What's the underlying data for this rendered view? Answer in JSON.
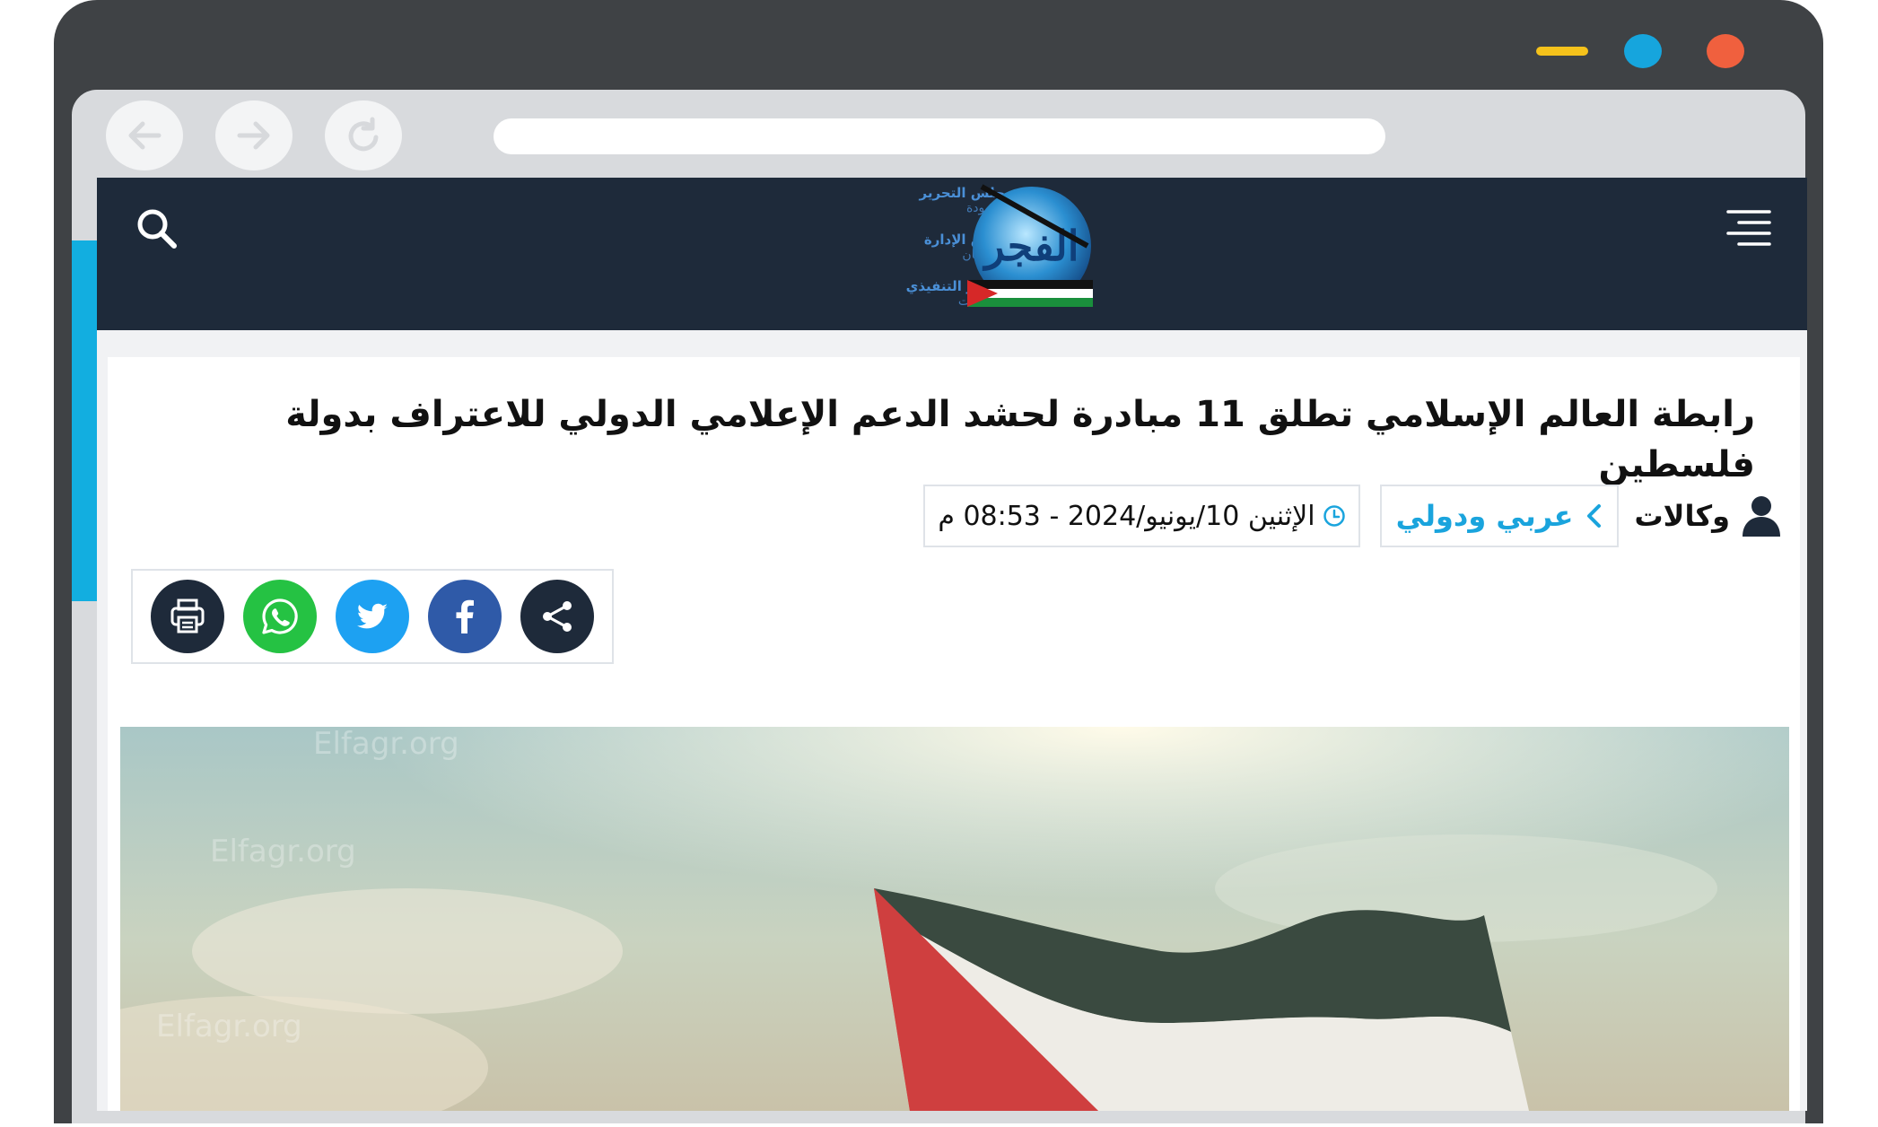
{
  "browser": {
    "colors": {
      "minimize": "#f5c21b",
      "maximize": "#16a5dd",
      "close": "#f0603e"
    }
  },
  "header": {
    "background": "#1e2a3a",
    "staff": [
      {
        "role": "رئيس مجلس التحرير",
        "name": "عادل حمودة"
      },
      {
        "role": "رئيس مجلس الإدارة",
        "name": "نصيف قزمان"
      },
      {
        "role": "رئيس التحرير التنفيذي",
        "name": "مصطفى ثابت"
      }
    ],
    "logo": {
      "text": "الفجر"
    }
  },
  "article": {
    "title": "رابطة العالم الإسلامي تطلق 11 مبادرة لحشد الدعم الإعلامي الدولي للاعتراف بدولة فلسطين",
    "author": "وكالات",
    "category": "عربي ودولي",
    "date": "الإثنين 10/يونيو/2024 - 08:53 م",
    "accent_color": "#1aa4dd"
  },
  "share": {
    "buttons": [
      {
        "name": "print",
        "color": "#1e2a3a"
      },
      {
        "name": "whatsapp",
        "color": "#25c243"
      },
      {
        "name": "twitter",
        "color": "#1da1f2"
      },
      {
        "name": "facebook",
        "color": "#2f5aa8"
      },
      {
        "name": "share",
        "color": "#1e2a3a"
      }
    ]
  },
  "hero": {
    "watermark": "Elfagr.org"
  }
}
